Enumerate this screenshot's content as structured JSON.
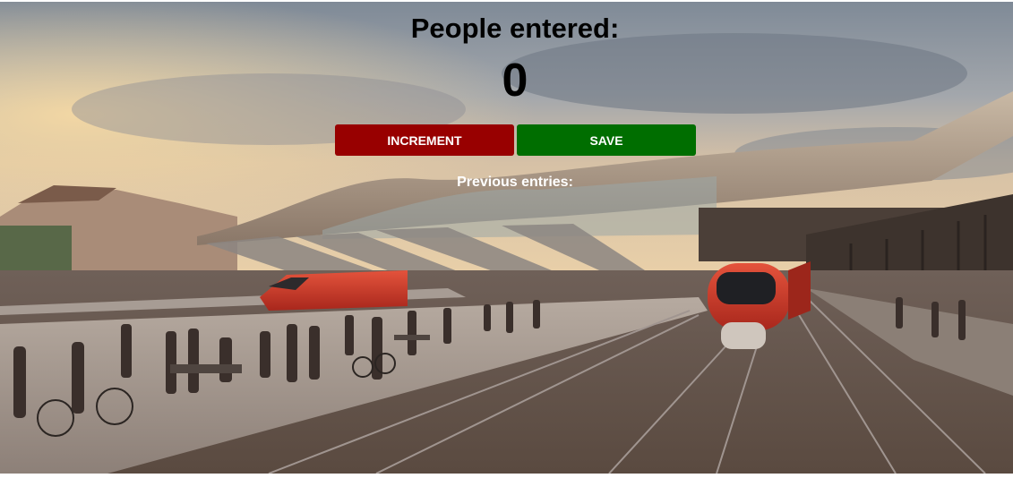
{
  "heading": "People entered:",
  "count": "0",
  "buttons": {
    "increment_label": "INCREMENT",
    "save_label": "SAVE"
  },
  "previous_entries_label": "Previous entries:",
  "colors": {
    "increment": "#980000",
    "save": "#006e00",
    "text": "#000000"
  }
}
